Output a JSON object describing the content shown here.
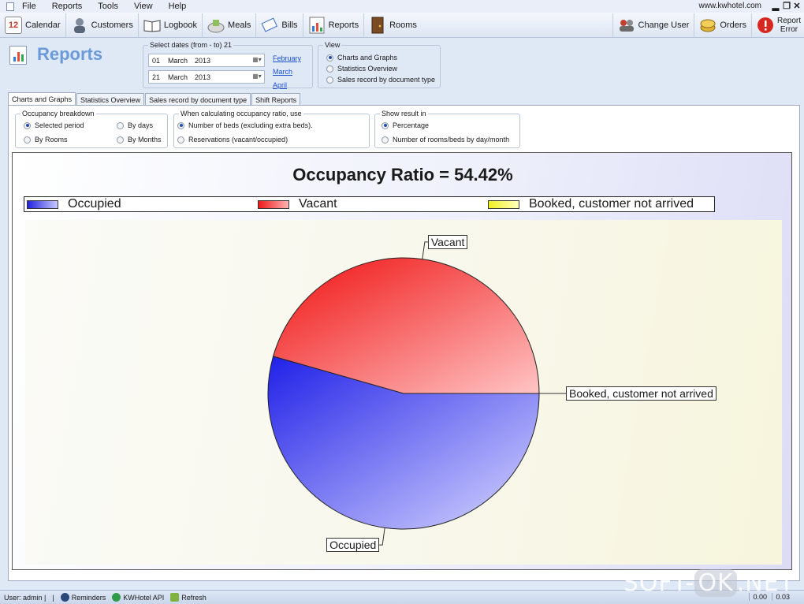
{
  "menu": {
    "items": [
      "File",
      "Reports",
      "Tools",
      "View",
      "Help"
    ],
    "site": "www.kwhotel.com"
  },
  "toolbar": {
    "left": [
      {
        "label": "Calendar",
        "icon": "calendar-icon"
      },
      {
        "label": "Customers",
        "icon": "customers-icon"
      },
      {
        "label": "Logbook",
        "icon": "logbook-icon"
      },
      {
        "label": "Meals",
        "icon": "meals-icon"
      },
      {
        "label": "Bills",
        "icon": "bills-icon"
      },
      {
        "label": "Reports",
        "icon": "reports-icon"
      },
      {
        "label": "Rooms",
        "icon": "rooms-icon"
      }
    ],
    "right": [
      {
        "label": "Change User",
        "icon": "change-user-icon"
      },
      {
        "label": "Orders",
        "icon": "orders-icon"
      },
      {
        "label": "Report Error",
        "icon": "report-error-icon"
      }
    ],
    "calendar_day": "12"
  },
  "header": {
    "title": "Reports",
    "dates_group_title": "Select dates (from - to) 21",
    "date_from": {
      "day": "01",
      "month": "March",
      "year": "2013"
    },
    "date_to": {
      "day": "21",
      "month": "March",
      "year": "2013"
    },
    "month_links": [
      "February",
      "March",
      "April"
    ],
    "view_group_title": "View",
    "view_options": [
      "Charts and Graphs",
      "Statistics Overview",
      "Sales record by document type"
    ],
    "view_selected": 0
  },
  "tabs": [
    "Charts and Graphs",
    "Statistics Overview",
    "Sales record by document type",
    "Shift Reports"
  ],
  "active_tab": 0,
  "options": {
    "breakdown_title": "Occupancy breakdown",
    "breakdown": [
      "Selected period",
      "By days",
      "By Rooms",
      "By Months"
    ],
    "ratio_title": "When calculating occupancy ratio, use",
    "ratio": [
      "Number of beds (excluding extra beds).",
      "Reservations (vacant/occupied)"
    ],
    "result_title": "Show result in",
    "result": [
      "Percentage",
      "Number of rooms/beds by day/month"
    ]
  },
  "chart_data": {
    "type": "pie",
    "title": "Occupancy Ratio = 54.42%",
    "series": [
      {
        "name": "Occupied",
        "value": 54.42,
        "color": "#3333ee"
      },
      {
        "name": "Vacant",
        "value": 45.58,
        "color": "#ee2222"
      },
      {
        "name": "Booked, customer not arrived",
        "value": 0,
        "color": "#f2f22a"
      }
    ],
    "legend": "top"
  },
  "status": {
    "user": "User: admin |",
    "items": [
      "Reminders",
      "KWHotel API",
      "Refresh"
    ],
    "values": [
      "0.00",
      "0.03"
    ]
  },
  "watermark": {
    "a": "SOFT-",
    "b": "OK",
    "c": ".NET"
  }
}
